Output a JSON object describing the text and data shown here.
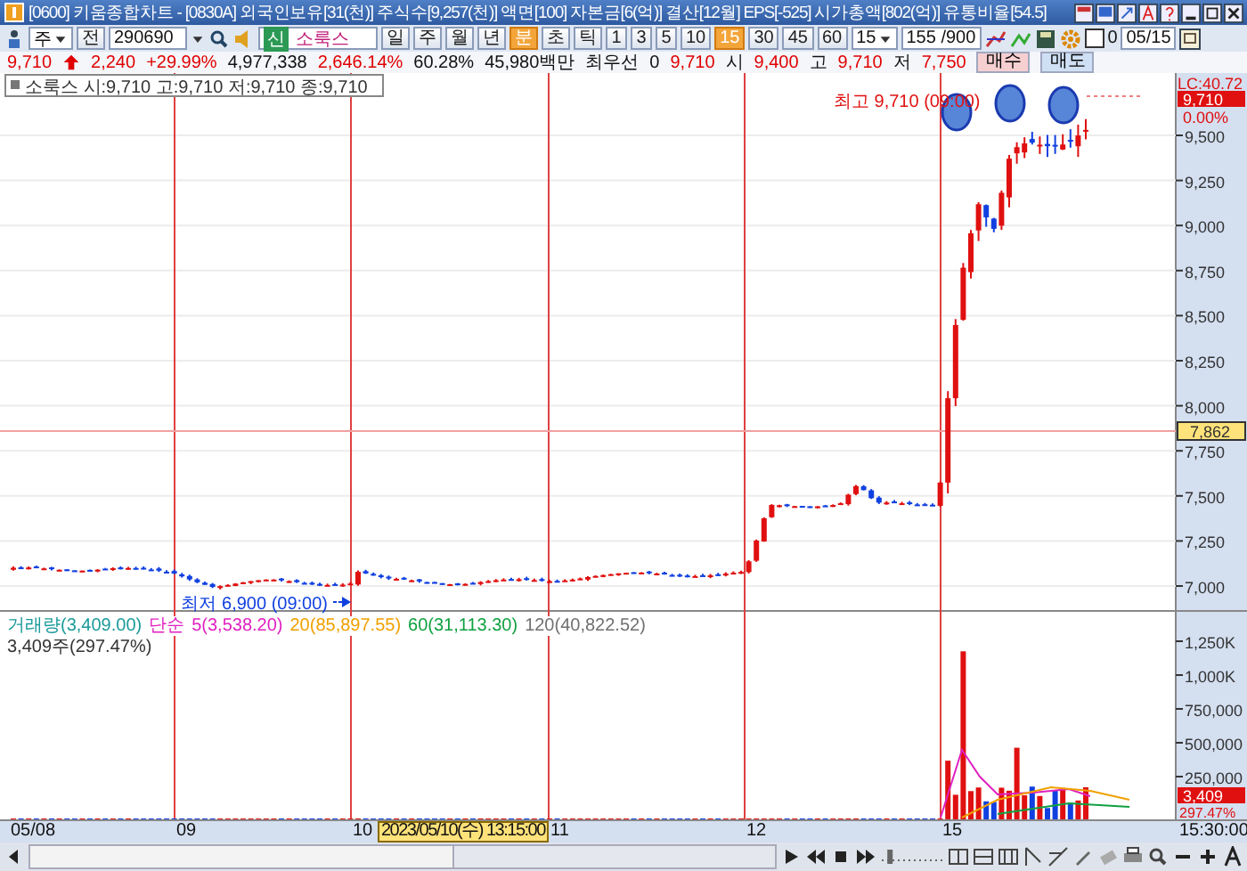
{
  "window": {
    "title": "[0600] 키움종합차트 - [0830A] 외국인보유[31(천)] 주식수[9,257(천)] 액면[100] 자본금[6(억)] 결산[12월] EPS[-525] 시가총액[802(억)] 유통비율[54.5]"
  },
  "toolbar": {
    "market": "주",
    "prev": "전",
    "code": "290690",
    "badge": "신",
    "name": "소룩스",
    "units": [
      {
        "label": "일",
        "selected": false
      },
      {
        "label": "주",
        "selected": false
      },
      {
        "label": "월",
        "selected": false
      },
      {
        "label": "년",
        "selected": false
      },
      {
        "label": "분",
        "selected": true
      },
      {
        "label": "초",
        "selected": false
      },
      {
        "label": "틱",
        "selected": false
      }
    ],
    "intervals": [
      {
        "label": "1",
        "selected": false
      },
      {
        "label": "3",
        "selected": false
      },
      {
        "label": "5",
        "selected": false
      },
      {
        "label": "10",
        "selected": false
      },
      {
        "label": "15",
        "selected": true
      },
      {
        "label": "30",
        "selected": false
      },
      {
        "label": "45",
        "selected": false
      },
      {
        "label": "60",
        "selected": false
      }
    ],
    "interval_value": "15",
    "bar_count": "155 /900",
    "speed": {
      "level": 0.1
    },
    "check": {
      "checked": false,
      "label": "0"
    },
    "date": "05/15"
  },
  "quote": {
    "fields": [
      {
        "text": "9,710",
        "up": true,
        "kind": "price"
      },
      {
        "text": "2,240",
        "up": true,
        "kind": "value"
      },
      {
        "text": "+29.99%",
        "up": true,
        "kind": "value"
      },
      {
        "text": "4,977,338",
        "up": false,
        "kind": "value"
      },
      {
        "text": "2,646.14%",
        "up": true,
        "kind": "value"
      },
      {
        "text": "60.28%",
        "up": false,
        "kind": "value"
      },
      {
        "text": "45,980백만",
        "up": false,
        "kind": "value"
      },
      {
        "text": "최우선",
        "up": false,
        "kind": "value"
      },
      {
        "text": "0",
        "up": false,
        "kind": "value"
      },
      {
        "text": "9,710",
        "up": true,
        "kind": "value"
      }
    ],
    "ohlc": [
      {
        "label": "시",
        "value": "9,400"
      },
      {
        "label": "고",
        "value": "9,710"
      },
      {
        "label": "저",
        "value": "7,750"
      }
    ],
    "buttons": [
      {
        "label": "매수",
        "kind": "buy"
      },
      {
        "label": "매도",
        "kind": "sell"
      }
    ]
  },
  "price_panel": {
    "legend_name": "소룩스",
    "legend_values": "시:9,710 고:9,710 저:9,710 종:9,710",
    "high_note": "최고 9,710 (09:00)",
    "low_note": "최저 6,900 (09:00)",
    "lc": "LC:40.72",
    "last_price": "9,710",
    "change": "0.00%",
    "ticks": [
      "9,500",
      "9,250",
      "9,000",
      "8,750",
      "8,500",
      "8,250",
      "8,000",
      "7,750",
      "7,500",
      "7,250",
      "7,000"
    ],
    "crosshair": "7,862"
  },
  "volume_panel": {
    "legend": [
      {
        "text": "거래량(3,409.00)",
        "color": "#1a9a9a"
      },
      {
        "text": "단순",
        "color": "#e020c0"
      },
      {
        "text": "5(3,538.20)",
        "color": "#e020c0"
      },
      {
        "text": "20(85,897.55)",
        "color": "#f0a000"
      },
      {
        "text": "60(31,113.30)",
        "color": "#10a040"
      },
      {
        "text": "120(40,822.52)",
        "color": "#707070"
      }
    ],
    "summary": "3,409주(297.47%)",
    "ticks": [
      "1,250K",
      "1,000K",
      "750,000",
      "500,000",
      "250,000"
    ],
    "last_volume": "3,409",
    "ratio": "297.47%"
  },
  "x_axis": {
    "labels": [
      "05/08",
      "09",
      "10",
      "11",
      "12",
      "15"
    ],
    "end_label": "15:30:00",
    "cursor": "2023/05/10(수) 13:15:00"
  }
}
